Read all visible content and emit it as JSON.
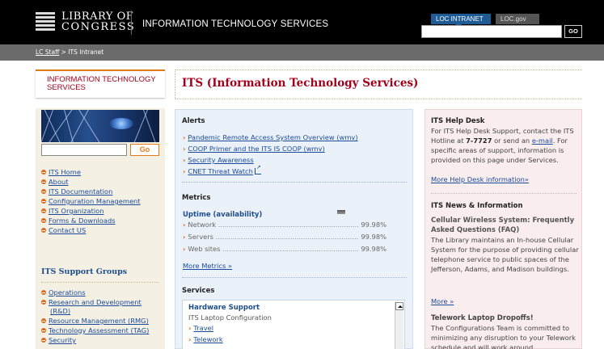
{
  "header": {
    "logo_line1": "LIBRARY OF",
    "logo_line2": "CONGRESS",
    "site_title": "INFORMATION TECHNOLOGY SERVICES",
    "tab_intranet": "LOC INTRANET",
    "tab_locgov": "LOC.gov",
    "search_value": "",
    "go_label": "GO"
  },
  "breadcrumb": {
    "link": "LC Staff",
    "separator": " > ",
    "current": "ITS Intranet"
  },
  "sidebar": {
    "title": "INFORMATION TECHNOLOGY SERVICES",
    "search_value": "",
    "go_label": "Go",
    "links": [
      "ITS Home",
      "About",
      "ITS Documentation",
      "Configuration Management",
      "ITS Organization",
      "Forms & Downloads",
      "Contact US"
    ],
    "support_heading": "ITS Support Groups",
    "support_links": [
      "Operations",
      "Research and Development",
      "(R&D)",
      "Resource Management (RMG)",
      "Technology Assessment (TAG)",
      "Security"
    ]
  },
  "page_title": "ITS (Information Technology Services)",
  "alerts": {
    "heading": "Alerts",
    "links": [
      "Pandemic Remote Access System Overview (wmv)",
      "COOP Primer and the ITS IS COOP (wmv)",
      "Security Awareness",
      "CNET Threat Watch"
    ]
  },
  "metrics": {
    "heading": "Metrics",
    "uptime_heading": "Uptime (availability)",
    "rows": [
      {
        "label": "Network",
        "value": "99.98%"
      },
      {
        "label": "Servers",
        "value": "99.98%"
      },
      {
        "label": "Web sites",
        "value": "99.98%"
      }
    ],
    "more_label": "More Metrics »"
  },
  "services": {
    "heading": "Services",
    "hardware_title": "Hardware Support",
    "hardware_sub": "ITS Laptop Configuration",
    "hardware_links": [
      "Travel",
      "Telework"
    ]
  },
  "helpdesk": {
    "heading": "ITS Help Desk",
    "text_1": "For ITS Help Desk Support, contact the ITS Hotline at ",
    "phone": "7-7727",
    "text_2": " or send an ",
    "email_link": "e-mail",
    "text_3": ". For specific areas of support, information is provided on this page under Services.",
    "more_link": "More Help Desk information»"
  },
  "news": {
    "heading": "ITS News & Information",
    "item1_title": "Cellular Wireless System: Frequently Asked Questions (FAQ)",
    "item1_text": "The Library maintains an In-house Cellular System for the purpose of providing cellular telephone service to public spaces of the Jefferson, Adams, and Madison buildings.",
    "more_label": "More »",
    "item2_title": "Telework Laptop Dropoffs!",
    "item2_text": "The Configurations Team is committed to minimizing any disruption to your Telework schedule and will work around"
  }
}
